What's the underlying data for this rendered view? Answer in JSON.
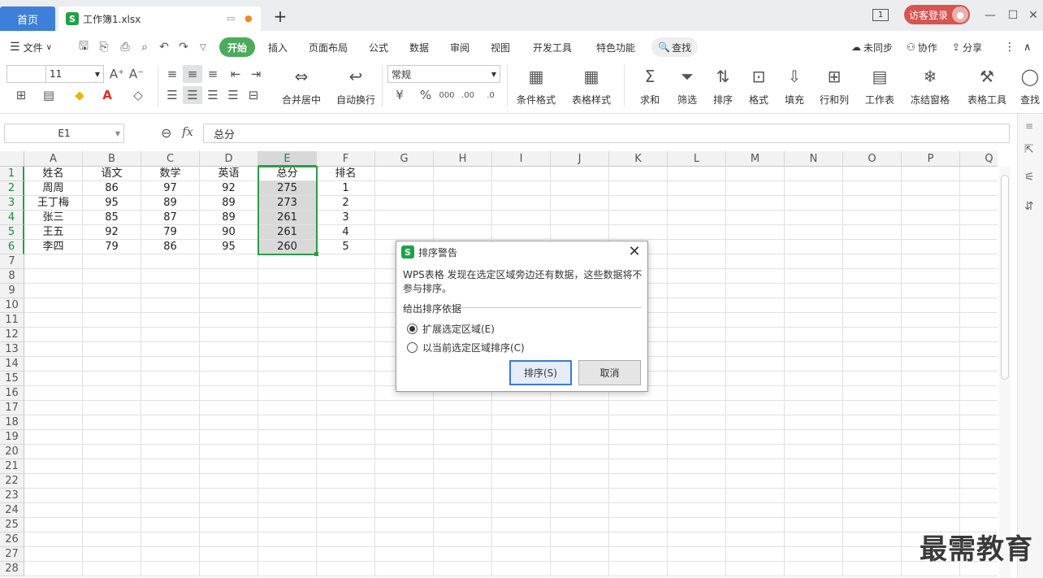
{
  "tabs": {
    "home": "首页",
    "file": "工作簿1.xlsx",
    "new_tab": "+"
  },
  "titlebar": {
    "page_indicator": "1",
    "login": "访客登录"
  },
  "menu": {
    "file": "文件",
    "items": [
      "开始",
      "插入",
      "页面布局",
      "公式",
      "数据",
      "审阅",
      "视图",
      "开发工具",
      "特色功能"
    ],
    "search": "查找",
    "right": [
      "未同步",
      "协作",
      "分享"
    ]
  },
  "ribbon": {
    "font_size": "11",
    "number_format": "常规",
    "merge_center": "合并居中",
    "wrap_text": "自动换行",
    "cond_format": "条件格式",
    "table_style": "表格样式",
    "tools": [
      "求和",
      "筛选",
      "排序",
      "格式",
      "填充",
      "行和列",
      "工作表",
      "冻结窗格",
      "表格工具",
      "查找"
    ]
  },
  "formula_bar": {
    "cell_ref": "E1",
    "fx": "fx",
    "content": "总分"
  },
  "sheet": {
    "columns": [
      "A",
      "B",
      "C",
      "D",
      "E",
      "F",
      "G",
      "H",
      "I",
      "J",
      "K",
      "L",
      "M",
      "N",
      "O",
      "P",
      "Q"
    ],
    "rows": [
      "1",
      "2",
      "3",
      "4",
      "5",
      "6",
      "7",
      "8",
      "9",
      "10",
      "11",
      "12",
      "13",
      "14",
      "15",
      "16",
      "17",
      "18",
      "19",
      "20",
      "21",
      "22",
      "23",
      "24",
      "25",
      "26",
      "27",
      "28"
    ],
    "cells": [
      [
        "姓名",
        "语文",
        "数学",
        "英语",
        "总分",
        "排名"
      ],
      [
        "周周",
        "86",
        "97",
        "92",
        "275",
        "1"
      ],
      [
        "王丁梅",
        "95",
        "89",
        "89",
        "273",
        "2"
      ],
      [
        "张三",
        "85",
        "87",
        "89",
        "261",
        "3"
      ],
      [
        "王五",
        "92",
        "79",
        "90",
        "261",
        "4"
      ],
      [
        "李四",
        "79",
        "86",
        "95",
        "260",
        "5"
      ]
    ]
  },
  "dialog": {
    "title": "排序警告",
    "message": "WPS表格 发现在选定区域旁边还有数据，这些数据将不参与排序。",
    "group_label": "给出排序依据",
    "option1": "扩展选定区域(E)",
    "option2": "以当前选定区域排序(C)",
    "sort_button": "排序(S)",
    "cancel_button": "取消"
  },
  "watermark": "最需教育",
  "colors": {
    "accent_green": "#2e9c48",
    "home_tab": "#3d7fd9",
    "login": "#d9534f"
  }
}
